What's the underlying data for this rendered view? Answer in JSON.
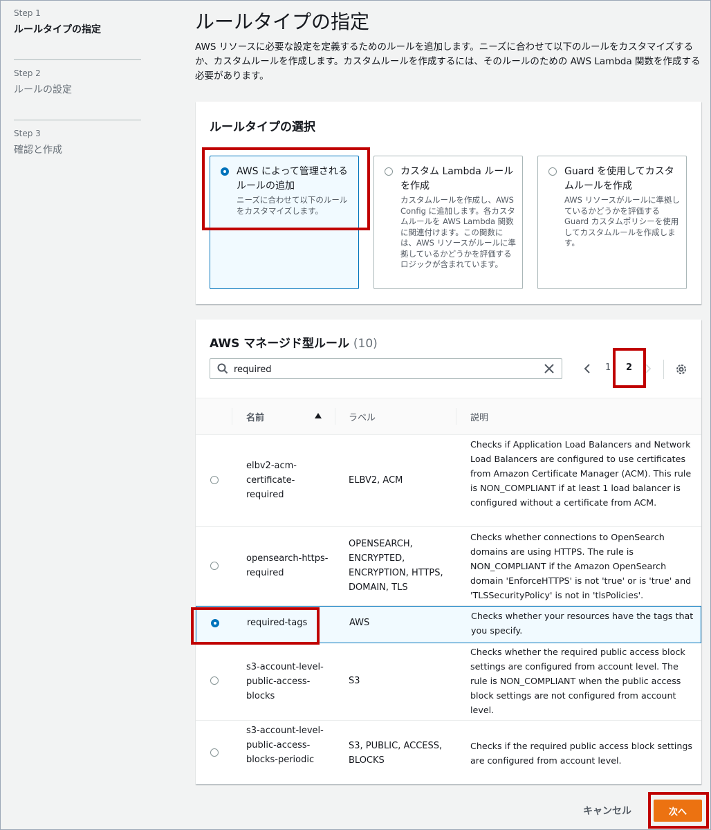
{
  "steps": [
    {
      "num": "Step 1",
      "title": "ルールタイプの指定"
    },
    {
      "num": "Step 2",
      "title": "ルールの設定"
    },
    {
      "num": "Step 3",
      "title": "確認と作成"
    }
  ],
  "page": {
    "title": "ルールタイプの指定",
    "description": "AWS リソースに必要な設定を定義するためのルールを追加します。ニーズに合わせて以下のルールをカスタマイズするか、カスタムルールを作成します。カスタムルールを作成するには、そのルールのための AWS Lambda 関数を作成する必要があります。"
  },
  "rule_type": {
    "title": "ルールタイプの選択",
    "options": [
      {
        "title": "AWS によって管理されるルールの追加",
        "desc": "ニーズに合わせて以下のルールをカスタマイズします。",
        "selected": true
      },
      {
        "title": "カスタム Lambda ルールを作成",
        "desc": "カスタムルールを作成し、AWS Config に追加します。各カスタムルールを AWS Lambda 関数に関連付けます。この関数には、AWS リソースがルールに準拠しているかどうかを評価するロジックが含まれています。",
        "selected": false
      },
      {
        "title": "Guard を使用してカスタムルールを作成",
        "desc": "AWS リソースがルールに準拠しているかどうかを評価する Guard カスタムポリシーを使用してカスタムルールを作成します。",
        "selected": false
      }
    ]
  },
  "managed_rules": {
    "title": "AWS マネージド型ルール",
    "count": "(10)",
    "search_value": "required",
    "pagination": {
      "page1": "1",
      "page2": "2",
      "current": "2"
    },
    "columns": {
      "name": "名前",
      "label": "ラベル",
      "description": "説明"
    },
    "sort_icon": "sort-ascending-icon",
    "rows": [
      {
        "name": "elbv2-acm-certificate-required",
        "labels": "ELBV2, ACM",
        "desc": "Checks if Application Load Balancers and Network Load Balancers are configured to use certificates from Amazon Certificate Manager (ACM). This rule is NON_COMPLIANT if at least 1 load balancer is configured without a certificate from ACM.",
        "selected": false
      },
      {
        "name": "opensearch-https-required",
        "labels": "OPENSEARCH, ENCRYPTED, ENCRYPTION, HTTPS, DOMAIN, TLS",
        "desc": "Checks whether connections to OpenSearch domains are using HTTPS. The rule is NON_COMPLIANT if the Amazon OpenSearch domain 'EnforceHTTPS' is not 'true' or is 'true' and 'TLSSecurityPolicy' is not in 'tlsPolicies'.",
        "selected": false
      },
      {
        "name": "required-tags",
        "labels": "AWS",
        "desc": "Checks whether your resources have the tags that you specify.",
        "selected": true
      },
      {
        "name": "s3-account-level-public-access-blocks",
        "labels": "S3",
        "desc": "Checks whether the required public access block settings are configured from account level. The rule is NON_COMPLIANT when the public access block settings are not configured from account level.",
        "selected": false
      },
      {
        "name": "s3-account-level-public-access-blocks-periodic",
        "labels": "S3, PUBLIC, ACCESS, BLOCKS",
        "desc": "Checks if the required public access block settings are configured from account level.",
        "selected": false
      }
    ]
  },
  "footer": {
    "cancel": "キャンセル",
    "next": "次へ"
  },
  "colors": {
    "accent": "#0073bb",
    "primary_button": "#ec7211",
    "annotation": "#c00000"
  }
}
